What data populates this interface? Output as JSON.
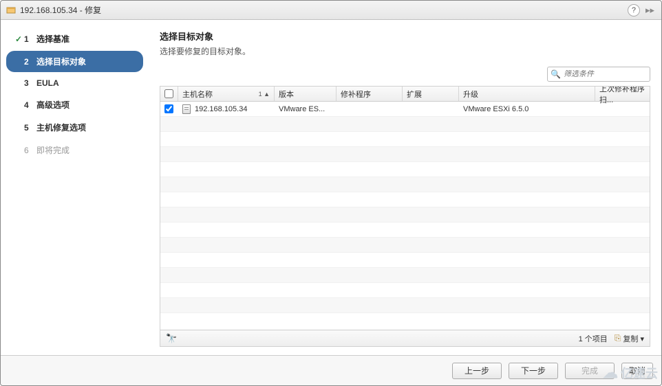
{
  "window": {
    "title": "192.168.105.34 - 修复"
  },
  "sidebar": {
    "steps": [
      {
        "num": "1",
        "label": "选择基准",
        "state": "completed"
      },
      {
        "num": "2",
        "label": "选择目标对象",
        "state": "active"
      },
      {
        "num": "3",
        "label": "EULA",
        "state": "future"
      },
      {
        "num": "4",
        "label": "高级选项",
        "state": "future"
      },
      {
        "num": "5",
        "label": "主机修复选项",
        "state": "future"
      },
      {
        "num": "6",
        "label": "即将完成",
        "state": "disabled"
      }
    ]
  },
  "main": {
    "heading": "选择目标对象",
    "subheading": "选择要修复的目标对象。",
    "filter_placeholder": "筛选条件",
    "columns": {
      "hostname": "主机名称",
      "sort_indicator": "1 ▲",
      "version": "版本",
      "patch": "修补程序",
      "extension": "扩展",
      "upgrade": "升级",
      "last_patch_scan": "上次修补程序扫..."
    },
    "rows": [
      {
        "checked": true,
        "hostname": "192.168.105.34",
        "version": "VMware ES...",
        "patch": "",
        "extension": "",
        "upgrade": "VMware ESXi 6.5.0",
        "last_patch_scan": ""
      }
    ],
    "footer": {
      "item_count": "1 个项目",
      "copy_label": "复制 ▾"
    }
  },
  "buttons": {
    "prev": "上一步",
    "next": "下一步",
    "finish": "完成",
    "cancel": "取消"
  },
  "watermark": "亿速云"
}
